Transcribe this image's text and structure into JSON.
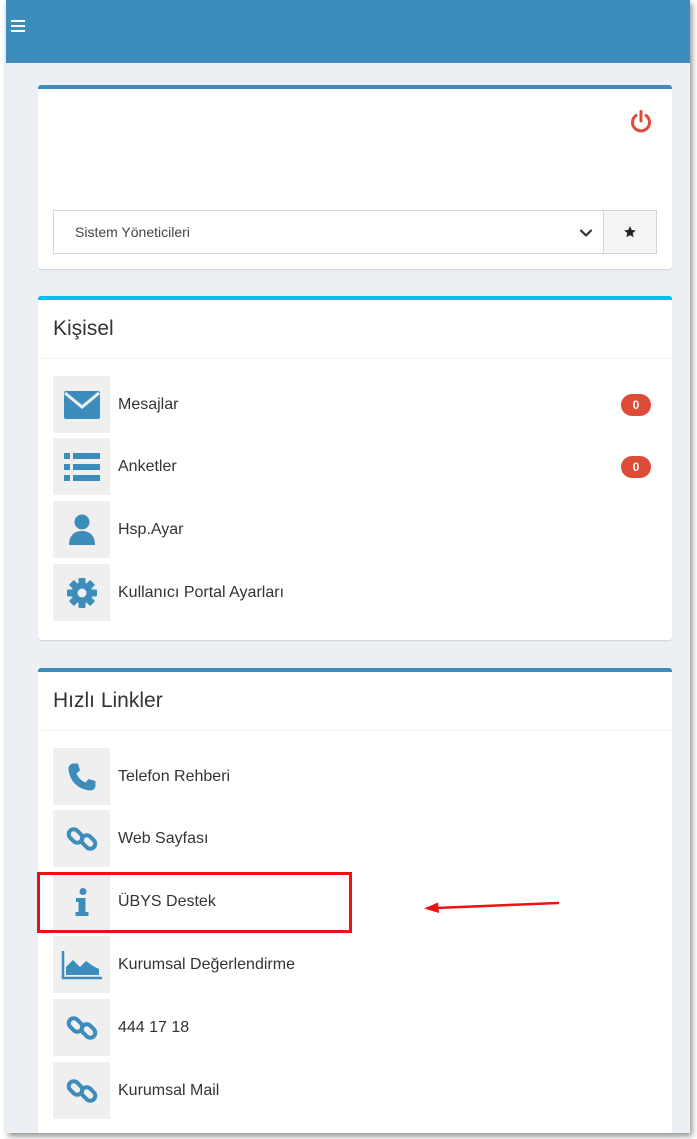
{
  "colors": {
    "primary": "#3c8dbc",
    "info": "#00c0ef",
    "danger": "#dd4b39",
    "annotation": "#ee1111"
  },
  "topbar": {
    "menu_icon": "hamburger-menu-icon"
  },
  "role_box": {
    "power_icon": "power-icon",
    "role_select": {
      "value": "Sistem Yöneticileri",
      "caret_icon": "chevron-down-icon"
    },
    "favorite_icon": "star-icon"
  },
  "kisisel": {
    "title": "Kişisel",
    "items": [
      {
        "label": "Mesajlar",
        "icon": "envelope-icon",
        "badge": "0"
      },
      {
        "label": "Anketler",
        "icon": "list-icon",
        "badge": "0"
      },
      {
        "label": "Hsp.Ayar",
        "icon": "user-icon"
      },
      {
        "label": "Kullanıcı Portal Ayarları",
        "icon": "gear-icon"
      }
    ]
  },
  "hizli_linkler": {
    "title": "Hızlı Linkler",
    "items": [
      {
        "label": "Telefon Rehberi",
        "icon": "phone-icon"
      },
      {
        "label": "Web Sayfası",
        "icon": "link-icon"
      },
      {
        "label": "ÜBYS Destek",
        "icon": "info-icon"
      },
      {
        "label": "Kurumsal Değerlendirme",
        "icon": "area-chart-icon"
      },
      {
        "label": "444 17 18",
        "icon": "link-icon"
      },
      {
        "label": "Kurumsal Mail",
        "icon": "link-icon"
      }
    ]
  }
}
